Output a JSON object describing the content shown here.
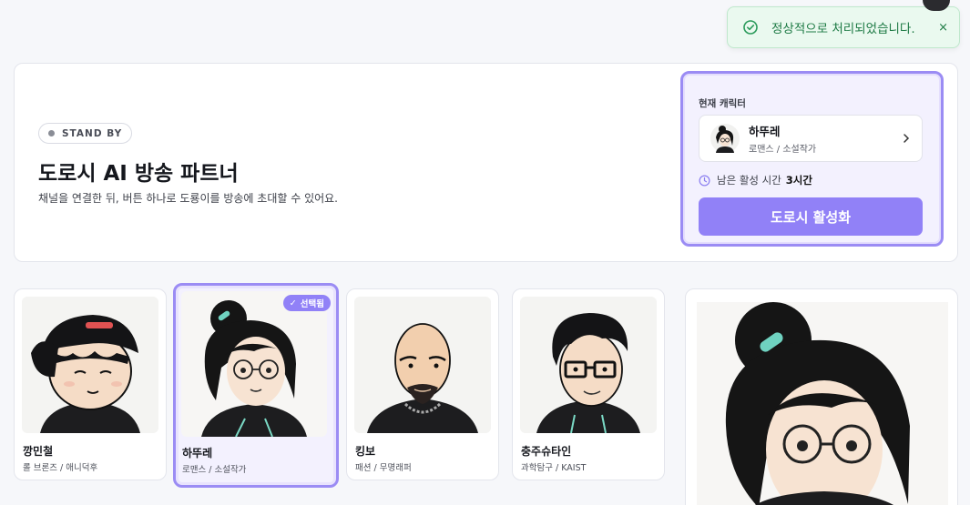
{
  "toast": {
    "message": "정상적으로 처리되었습니다.",
    "close_label": "×"
  },
  "hero": {
    "status_badge": "STAND BY",
    "title": "도로시 AI 방송 파트너",
    "description": "채널을 연결한 뒤, 버튼 하나로 도룡이를 방송에 초대할 수 있어요."
  },
  "current_panel": {
    "label": "현재 캐릭터",
    "character_name": "하뚜레",
    "character_tags": "로맨스 / 소설작가",
    "remaining_prefix": "남은 활성 시간",
    "remaining_value": "3시간",
    "activate_label": "도로시 활성화"
  },
  "characters": [
    {
      "name": "깡민철",
      "tags": "롤 브론즈 / 애니덕후",
      "selected": false
    },
    {
      "name": "하뚜레",
      "tags": "로맨스 / 소설작가",
      "selected": true,
      "badge": "선택됨"
    },
    {
      "name": "킹보",
      "tags": "패션 / 무명래퍼",
      "selected": false
    },
    {
      "name": "충주슈타인",
      "tags": "과학탐구 / KAIST",
      "selected": false
    }
  ],
  "colors": {
    "accent": "#9181f7",
    "toast_bg": "#eaf9ef",
    "toast_text": "#1d7a44"
  }
}
